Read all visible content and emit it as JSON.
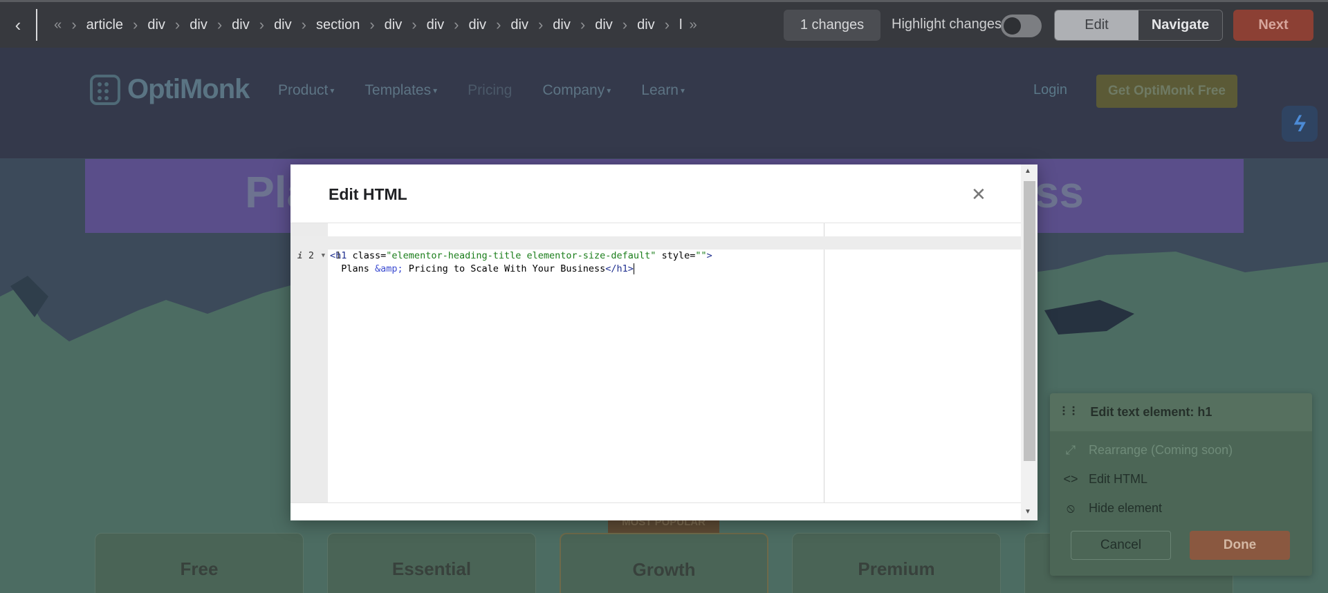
{
  "toolbar": {
    "back_icon": "chevron-left-icon",
    "breadcrumbs": [
      "article",
      "div",
      "div",
      "div",
      "div",
      "section",
      "div",
      "div",
      "div",
      "div",
      "div",
      "div",
      "div",
      "l"
    ],
    "changes": "1 changes",
    "highlight_label": "Highlight changes",
    "highlight_on": false,
    "mode_edit": "Edit",
    "mode_navigate": "Navigate",
    "next": "Next"
  },
  "site": {
    "logo_text": "OptiMonk",
    "nav": [
      "Product",
      "Templates",
      "Pricing",
      "Company",
      "Learn"
    ],
    "login": "Login",
    "cta": "Get OptiMonk Free",
    "hero_left": "Pla",
    "hero_right": "ess",
    "popular_tag": "MOST POPULAR",
    "plans": [
      "Free",
      "Essential",
      "Growth",
      "Premium"
    ]
  },
  "modal": {
    "title": "Edit HTML",
    "close_icon": "close-icon",
    "lines": [
      {
        "number": "1"
      },
      {
        "number": "2"
      }
    ],
    "code": {
      "l1_open": "<h1",
      "l1_attr1": " class=",
      "l1_val1": "\"elementor-heading-title elementor-size-default\"",
      "l1_attr2": " style=",
      "l1_val2": "\"\"",
      "l1_close": ">",
      "l2_text1": "  Plans ",
      "l2_entity": "&amp;",
      "l2_text2": " Pricing to Scale With Your Business",
      "l2_close": "</h1>"
    }
  },
  "panel": {
    "title": "Edit text element: h1",
    "rearrange": "Rearrange (Coming soon)",
    "edit_html": "Edit HTML",
    "hide": "Hide element",
    "cancel": "Cancel",
    "done": "Done"
  }
}
